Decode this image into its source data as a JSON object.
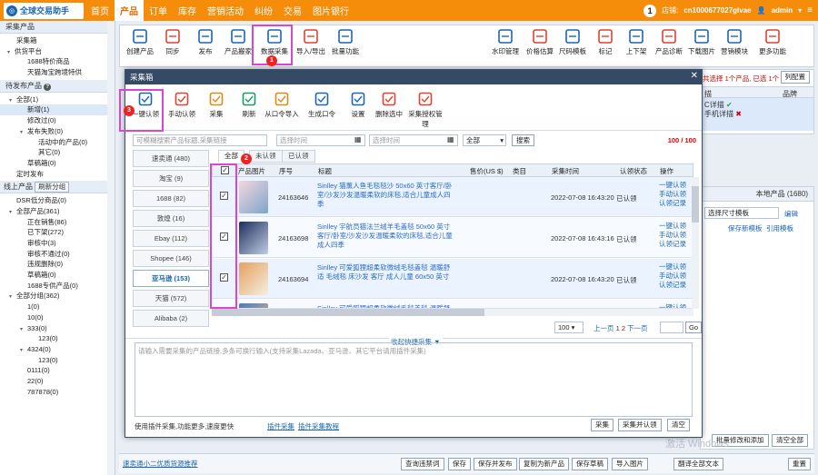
{
  "app": {
    "logo_text": "全球交易助手",
    "logo_icon": "globe-logo-icon"
  },
  "nav": [
    "首页",
    "产品",
    "订单",
    "库存",
    "营销活动",
    "纠纷",
    "交易",
    "图片银行"
  ],
  "nav_active": 1,
  "topright": {
    "badge": "1",
    "store_label": "店铺:",
    "store_name": "cn1000677027glvae",
    "user": "admin"
  },
  "sidebar": {
    "sec1": "采集产品",
    "items1": [
      "采集箱",
      "供货平台",
      "1688特价商品",
      "天猫淘宝跨境特供"
    ],
    "sec2": "待发布产品",
    "items2": [
      "全部(1)",
      "新增(1)",
      "修改过(0)",
      "发布失败(0)",
      "活动中的产品(0)",
      "其它(0)",
      "草稿箱(0)",
      "定时发布"
    ],
    "sec3_a": "线上产品",
    "sec3_b": "刷新分组",
    "items3": [
      "DSR低分商品(0)",
      "全部产品(361)",
      "正在销售(86)",
      "已下架(272)",
      "审核中(3)",
      "审核不通过(0)",
      "违规删除(0)",
      "草稿箱(0)",
      "1688专供产品(0)",
      "全部分组(362)",
      "1(0)",
      "10(0)",
      "333(0)",
      "123(0)",
      "4324(0)",
      "123(0)",
      "0111(0)",
      "22(0)",
      "787878(0)"
    ]
  },
  "maintool": [
    "创建产品",
    "同步",
    "发布",
    "产品搬家",
    "数据采集",
    "导入/导出",
    "批量功能",
    "水印管理",
    "价格估算",
    "尺码模板",
    "标记",
    "上下架",
    "产品诊断",
    "下载图片",
    "营销模块",
    "更多功能"
  ],
  "rpanel": {
    "select_text": "共选择 1个产品, 已选 1个",
    "sel_count": "1",
    "column_btn": "列配置",
    "col_a": "描",
    "col_b": "品牌",
    "line1": "C详描",
    "line2": "手机详描",
    "local_label": "本地产品 (1680)",
    "size_tpl": "选择尺寸模板",
    "edit": "编辑",
    "save_tpl": "保存新模板",
    "ref_tpl": "引用模板",
    "batch_btn": "批量修改和添加",
    "clear_btn": "清空全部"
  },
  "bottombar": {
    "link": "速卖通小二优质货源推荐",
    "buttons": [
      "查询违禁词",
      "保存",
      "保存并发布",
      "复制为新产品",
      "保存草稿",
      "导入图片",
      "翻译全部文本",
      "重置"
    ]
  },
  "dialog": {
    "title": "采集箱",
    "close": "✕",
    "toolbar": [
      "一键认领",
      "手动认领",
      "采集",
      "刷新",
      "从口令导入",
      "生成口令",
      "设置",
      "删除选中",
      "采集授权管理"
    ],
    "search_ph": "可模糊搜索产品标题,采集链接",
    "time1_ph": "选择时间",
    "time2_ph": "选择时间",
    "status_sel": "全部",
    "search_btn": "搜索",
    "count": "100 / 100",
    "sources": [
      "速卖通 (480)",
      "淘宝 (9)",
      "1688 (82)",
      "敦煌 (16)",
      "Ebay (112)",
      "Shopee (146)",
      "亚马逊 (153)",
      "天猫 (572)",
      "Alibaba (2)"
    ],
    "source_active": 6,
    "tabs": [
      "全部",
      "未认领",
      "已认领"
    ],
    "columns": [
      "产品图片",
      "序号",
      "标题",
      "售价(US $)",
      "类目",
      "采集时间",
      "认领状态",
      "操作"
    ],
    "rows": [
      {
        "id": "24163646",
        "title": "Sinlley 猫薰人鱼毛毯毯沙 50x60 英寸客厅/卧室/沙发沙发温暖柔软的床毯,适合儿童成人四季",
        "time": "2022-07-08 16:43:20",
        "status": "已认领",
        "ops": [
          "一键认领",
          "手动认领",
          "认领记录"
        ],
        "color1": "#f2d7e0",
        "color2": "#7fa5c8"
      },
      {
        "id": "24163698",
        "title": "Sinlley 宇航员猫法兰绒羊毛盖毯 50x60 英寸客厅/卧室/沙发沙发温暖柔软的床毯,适合儿童成人四季",
        "time": "2022-07-08 16:43:16",
        "status": "已认领",
        "ops": [
          "一键认领",
          "手动认领",
          "认领记录"
        ],
        "color1": "#1d2e5a",
        "color2": "#c0cde6"
      },
      {
        "id": "24163694",
        "title": "Sinlley 可爱狐狸超柔软微绒毛毯盖毯 温暖舒适 毛绒毯 床沙发 客厅 成人儿童 60x50 英寸",
        "time": "2022-07-08 16:43:20",
        "status": "已认领",
        "ops": [
          "一键认领",
          "手动认领",
          "认领记录"
        ],
        "color1": "#e6a060",
        "color2": "#f5efe0"
      },
      {
        "id": "",
        "title": "Sinlley 可爱狐狸超柔软微绒毛毯盖毯 温暖舒适",
        "time": "",
        "status": "",
        "ops": [
          "一键认领"
        ],
        "color1": "#4a7ab8",
        "color2": "#e8c090"
      }
    ],
    "per_page": "100",
    "pager": {
      "prev": "上一页",
      "p1": "1",
      "p2": "2",
      "next": "下一页",
      "go": "Go"
    },
    "collapse": "收起快捷采集",
    "textarea_ph": "请输入需要采集的产品链接,多条可换行输入(支持采集Lazada、亚马逊、其它平台请用插件采集)",
    "plugin_tip": "使用插件采集,功能更多,速度更快",
    "plugin_link": "插件采集",
    "plugin_tutorial": "插件采集教程",
    "btn_collect": "采集",
    "btn_collect_claim": "采集并认领",
    "btn_clear": "清空"
  },
  "annot": [
    "1",
    "2",
    "3"
  ],
  "watermark": "激活 Windows"
}
